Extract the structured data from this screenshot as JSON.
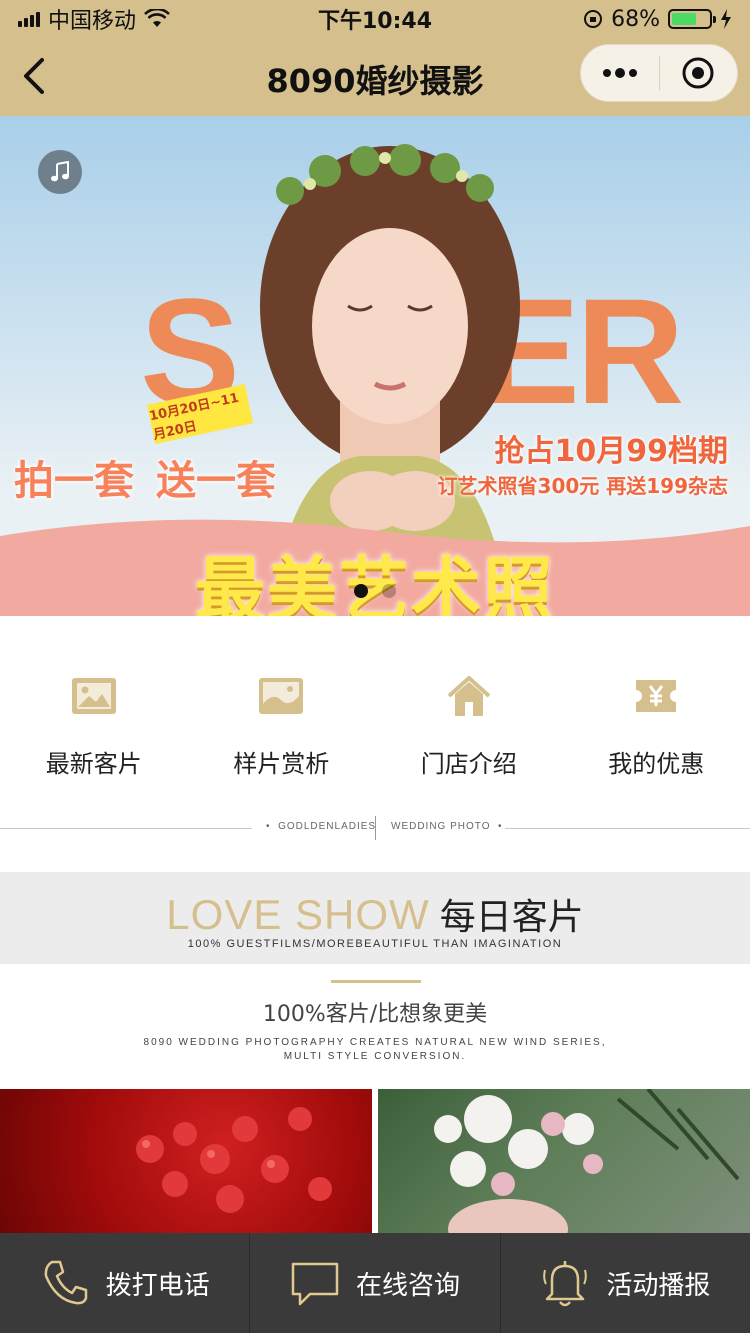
{
  "status_bar": {
    "carrier": "中国移动",
    "time": "下午10:44",
    "battery_percent": "68%",
    "battery_level": 0.68
  },
  "nav": {
    "title": "8090婚纱摄影"
  },
  "banner": {
    "big_text_left": "S",
    "big_text_right": "ER",
    "date_tag": "10月20日~11月20日",
    "promo_left_1": "拍一套",
    "promo_left_2": "送一套",
    "promo_right_1": "抢占10月99档期",
    "promo_right_2": "订艺术照省300元 再送199杂志",
    "headline": "最美艺术照",
    "active_slide": 1,
    "slide_count": 2
  },
  "quick_menu": [
    {
      "label": "最新客片",
      "icon": "image-icon"
    },
    {
      "label": "样片赏析",
      "icon": "photo-frame-icon"
    },
    {
      "label": "门店介绍",
      "icon": "home-icon"
    },
    {
      "label": "我的优惠",
      "icon": "yen-ticket-icon"
    }
  ],
  "divider": {
    "left_text": "GODLDENLADIES",
    "right_text": "WEDDING PHOTO"
  },
  "love_show": {
    "title_en": "LOVE SHOW",
    "title_cn": "每日客片",
    "subtitle": "100% GUESTFILMS/MOREBEAUTIFUL THAN IMAGINATION"
  },
  "tagline": "100%客片/比想象更美",
  "description_line1": "8090 WEDDING PHOTOGRAPHY CREATES NATURAL NEW WIND SERIES,",
  "description_line2": "MULTI STYLE CONVERSION.",
  "bottom_bar": [
    {
      "label": "拨打电话",
      "icon": "phone-icon"
    },
    {
      "label": "在线咨询",
      "icon": "chat-icon"
    },
    {
      "label": "活动播报",
      "icon": "bell-icon"
    }
  ],
  "colors": {
    "gold": "#d4bf8d",
    "bar_dark": "#3a3a3a",
    "headline_yellow": "#ffe94a",
    "promo_orange": "#f0653c"
  }
}
